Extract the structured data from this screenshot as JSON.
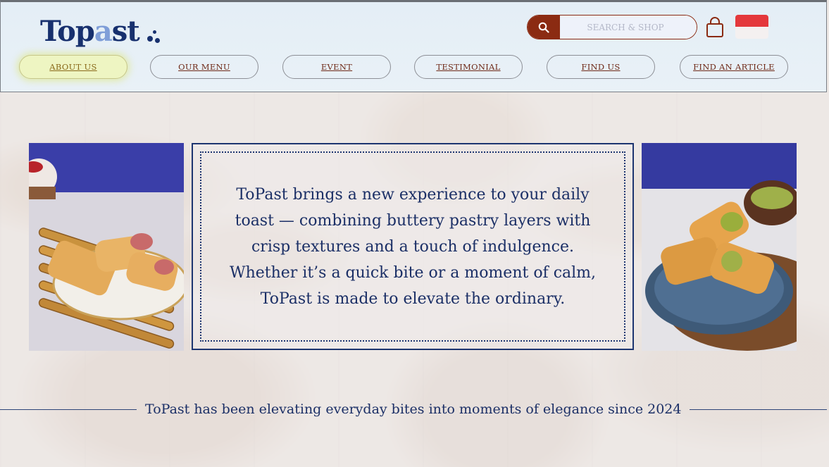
{
  "header": {
    "logo_text_1": "Top",
    "logo_text_a": "a",
    "logo_text_2": "st",
    "search_placeholder": "SEARCH & SHOP",
    "search_icon": "search-icon",
    "cart_icon": "shopping-bag-icon",
    "flag": "indonesia-flag"
  },
  "nav": [
    {
      "label": "ABOUT US",
      "active": true
    },
    {
      "label": "OUR MENU"
    },
    {
      "label": "EVENT"
    },
    {
      "label": "TESTIMONIAL"
    },
    {
      "label": "FIND US"
    },
    {
      "label": "FIND AN ARTICLE"
    }
  ],
  "about": {
    "text": "ToPast brings a new experience to your daily toast — combining buttery pastry layers with crisp textures and a touch of indulgence. Whether it’s a quick bite or a moment of calm, ToPast is made to elevate the ordinary."
  },
  "tagline": "ToPast has been elevating everyday bites into moments of elegance since 2024",
  "colors": {
    "brand_navy": "#17306e",
    "accent_brown": "#8b2b12",
    "active_nav": "#eef5c2"
  }
}
